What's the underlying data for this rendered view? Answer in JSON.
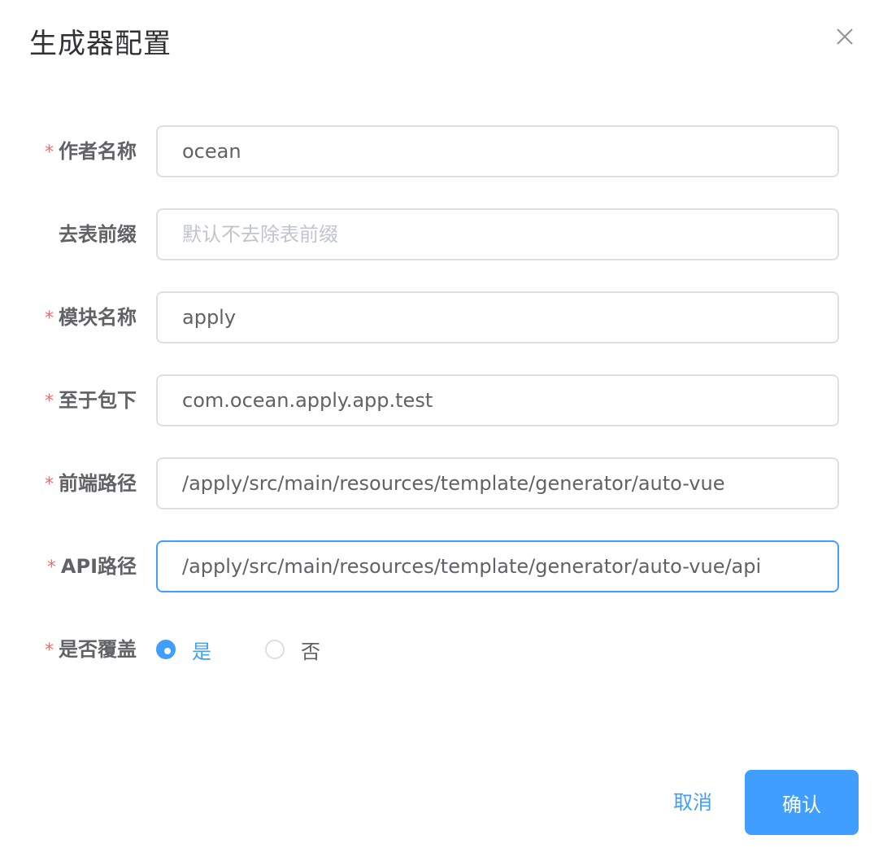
{
  "dialog": {
    "title": "生成器配置",
    "close_icon": "close-icon"
  },
  "form": {
    "required_mark": "*",
    "fields": [
      {
        "label": "作者名称",
        "required": true,
        "value": "ocean",
        "placeholder": ""
      },
      {
        "label": "去表前缀",
        "required": false,
        "value": "",
        "placeholder": "默认不去除表前缀"
      },
      {
        "label": "模块名称",
        "required": true,
        "value": "apply",
        "placeholder": ""
      },
      {
        "label": "至于包下",
        "required": true,
        "value": "com.ocean.apply.app.test",
        "placeholder": ""
      },
      {
        "label": "前端路径",
        "required": true,
        "value": "/apply/src/main/resources/template/generator/auto-vue",
        "placeholder": ""
      },
      {
        "label": "API路径",
        "required": true,
        "value": "/apply/src/main/resources/template/generator/auto-vue/api",
        "placeholder": "",
        "focused": true
      }
    ],
    "overwrite": {
      "label": "是否覆盖",
      "required": true,
      "options": [
        {
          "label": "是",
          "checked": true
        },
        {
          "label": "否",
          "checked": false
        }
      ]
    }
  },
  "footer": {
    "cancel_label": "取消",
    "confirm_label": "确认"
  },
  "colors": {
    "primary": "#409eff",
    "required": "#f56c6c",
    "border": "#dcdfe6"
  }
}
